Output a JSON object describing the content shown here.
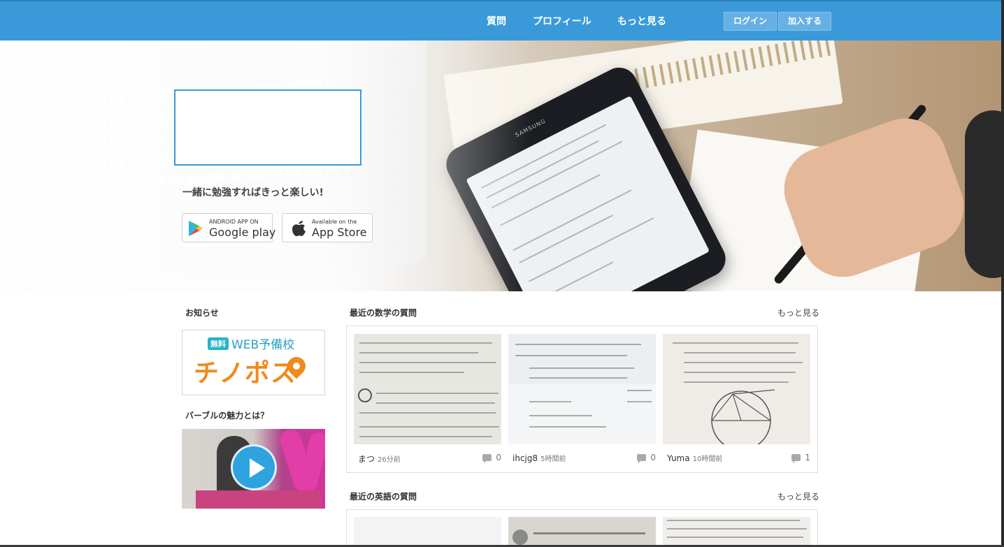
{
  "nav": {
    "links": [
      "質問",
      "プロフィール",
      "もっと見る"
    ],
    "login": "ログイン",
    "join": "加入する"
  },
  "hero": {
    "tagline": "一緒に勉強すればきっと楽しい!",
    "google": {
      "small": "ANDROID APP ON",
      "big": "Google play"
    },
    "apple": {
      "small": "Available on the",
      "big": "App Store"
    },
    "phone_brand": "SAMSUNG"
  },
  "sidebar": {
    "notice_title": "お知らせ",
    "banner": {
      "free": "無料",
      "web": "WEB予備校",
      "main": "チノポス"
    },
    "video_title": "バーブルの魅力とは？"
  },
  "math": {
    "title": "最近の数学の質問",
    "more": "もっと見る",
    "cards": [
      {
        "user": "まつ",
        "time": "26分前",
        "count": "0"
      },
      {
        "user": "ihcjg8",
        "time": "5時間前",
        "count": "0"
      },
      {
        "user": "Yuma",
        "time": "10時間前",
        "count": "1"
      }
    ]
  },
  "english": {
    "title": "最近の英語の質問",
    "more": "もっと見る"
  },
  "colors": {
    "brand": "#3a9ad9",
    "accent": "#f08a1c"
  }
}
